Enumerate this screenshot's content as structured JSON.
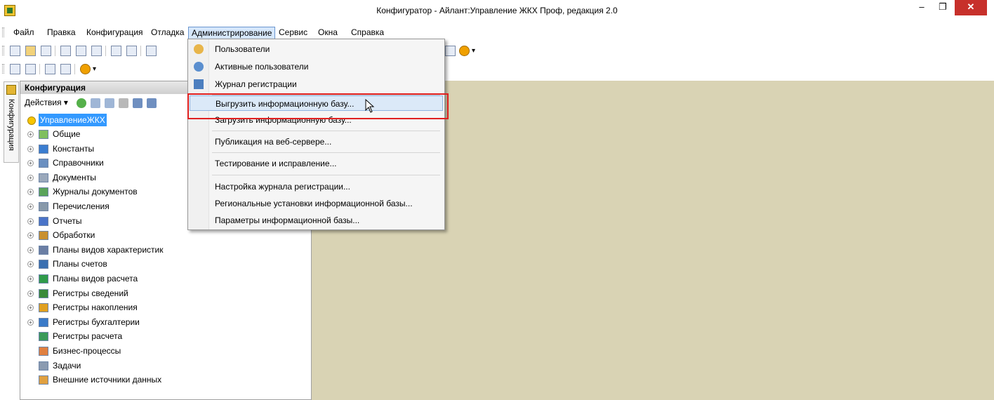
{
  "window": {
    "title": "Конфигуратор - Айлант:Управление ЖКХ Проф, редакция 2.0",
    "min_glyph": "–",
    "max_glyph": "❐",
    "close_glyph": "✕"
  },
  "menubar": {
    "items": [
      "Файл",
      "Правка",
      "Конфигурация",
      "Отладка",
      "Администрирование",
      "Сервис",
      "Окна",
      "Справка"
    ],
    "active": "Администрирование"
  },
  "side_tab": {
    "label": "Конфигурация"
  },
  "panel": {
    "title": "Конфигурация",
    "actions_label": "Действия ▾",
    "tree": {
      "root": "УправлениеЖКХ",
      "items": [
        {
          "label": "Общие",
          "icon": "common-icon",
          "expandable": true
        },
        {
          "label": "Константы",
          "icon": "constants-icon",
          "expandable": true
        },
        {
          "label": "Справочники",
          "icon": "catalogs-icon",
          "expandable": true
        },
        {
          "label": "Документы",
          "icon": "documents-icon",
          "expandable": true
        },
        {
          "label": "Журналы документов",
          "icon": "document-journals-icon",
          "expandable": true
        },
        {
          "label": "Перечисления",
          "icon": "enums-icon",
          "expandable": true
        },
        {
          "label": "Отчеты",
          "icon": "reports-icon",
          "expandable": true
        },
        {
          "label": "Обработки",
          "icon": "data-processors-icon",
          "expandable": true
        },
        {
          "label": "Планы видов характеристик",
          "icon": "chart-of-characteristic-types-icon",
          "expandable": true
        },
        {
          "label": "Планы счетов",
          "icon": "chart-of-accounts-icon",
          "expandable": true
        },
        {
          "label": "Планы видов расчета",
          "icon": "chart-of-calculation-types-icon",
          "expandable": true
        },
        {
          "label": "Регистры сведений",
          "icon": "information-registers-icon",
          "expandable": true
        },
        {
          "label": "Регистры накопления",
          "icon": "accumulation-registers-icon",
          "expandable": true
        },
        {
          "label": "Регистры бухгалтерии",
          "icon": "accounting-registers-icon",
          "expandable": true
        },
        {
          "label": "Регистры расчета",
          "icon": "calculation-registers-icon",
          "expandable": false
        },
        {
          "label": "Бизнес-процессы",
          "icon": "business-processes-icon",
          "expandable": false
        },
        {
          "label": "Задачи",
          "icon": "tasks-icon",
          "expandable": false
        },
        {
          "label": "Внешние источники данных",
          "icon": "external-data-sources-icon",
          "expandable": false
        }
      ]
    }
  },
  "admin_menu": {
    "items": [
      {
        "label": "Пользователи",
        "icon": "users-icon"
      },
      {
        "label": "Активные пользователи",
        "icon": "active-users-icon"
      },
      {
        "label": "Журнал регистрации",
        "icon": "event-log-icon"
      },
      {
        "label": "Выгрузить информационную базу...",
        "highlighted": true
      },
      {
        "label": "Загрузить информационную базу..."
      },
      {
        "label": "Публикация на веб-сервере..."
      },
      {
        "label": "Тестирование и исправление..."
      },
      {
        "label": "Настройка журнала регистрации..."
      },
      {
        "label": "Региональные установки информационной базы..."
      },
      {
        "label": "Параметры информационной базы..."
      }
    ]
  },
  "colors": {
    "workspace": "#d9d3b4",
    "selection": "#3399ff",
    "highlight_frame": "#e02020",
    "close_button": "#c7302b"
  }
}
